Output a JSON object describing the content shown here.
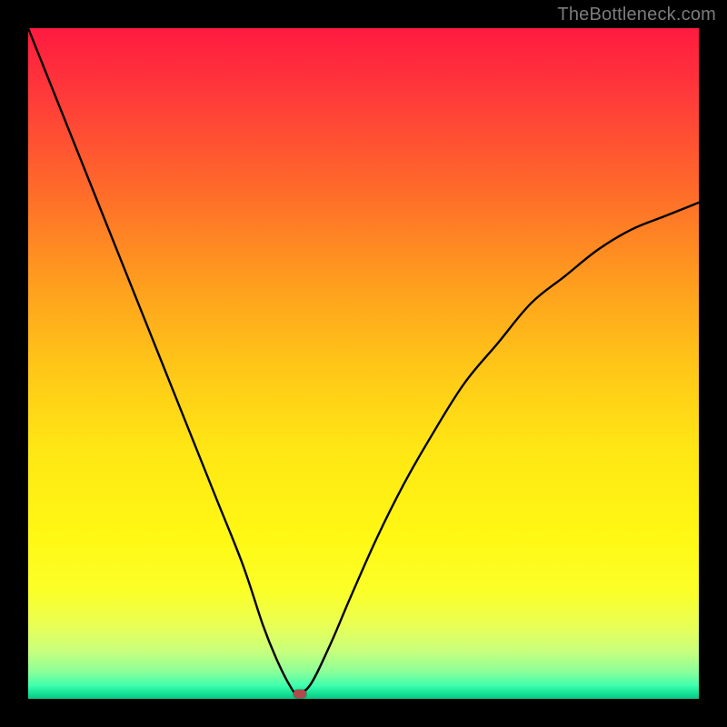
{
  "watermark": {
    "text": "TheBottleneck.com"
  },
  "chart_data": {
    "type": "line",
    "title": "",
    "xlabel": "",
    "ylabel": "",
    "xlim": [
      0,
      100
    ],
    "ylim": [
      0,
      100
    ],
    "grid": false,
    "legend": false,
    "series": [
      {
        "name": "curve",
        "x": [
          0,
          4,
          8,
          12,
          16,
          20,
          24,
          28,
          32,
          35,
          37,
          39,
          40,
          42,
          45,
          48,
          52,
          56,
          60,
          65,
          70,
          75,
          80,
          85,
          90,
          95,
          100
        ],
        "y": [
          100,
          90,
          80,
          70,
          60,
          50,
          40,
          30,
          20,
          11,
          6,
          2,
          1,
          2,
          8,
          15,
          24,
          32,
          39,
          47,
          53,
          59,
          63,
          67,
          70,
          72,
          74
        ]
      }
    ],
    "marker": {
      "x": 40.5,
      "y": 0.7,
      "w": 1.8,
      "h": 1.2,
      "color": "#b14a4a"
    },
    "background_gradient": {
      "top": "#ff1a40",
      "mid": "#ffe714",
      "bottom": "#0ec484"
    }
  }
}
